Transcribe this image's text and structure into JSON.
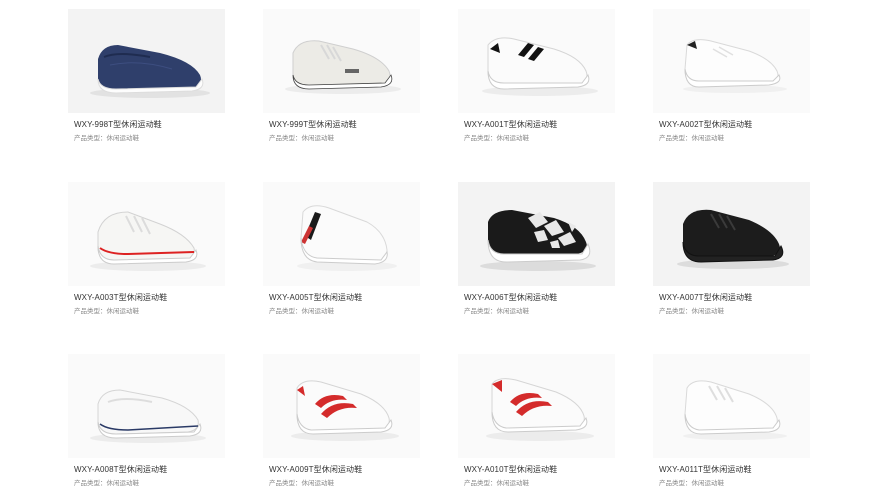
{
  "products": [
    {
      "model": "WXY-998T型休闲运动鞋",
      "category_label": "产品类型：",
      "category_value": "休闲运动鞋",
      "shoe": "navy-slip-on-canvas-icon"
    },
    {
      "model": "WXY-999T型休闲运动鞋",
      "category_label": "产品类型：",
      "category_value": "休闲运动鞋",
      "shoe": "white-lace-up-canvas-icon"
    },
    {
      "model": "WXY-A001T型休闲运动鞋",
      "category_label": "产品类型：",
      "category_value": "休闲运动鞋",
      "shoe": "white-sneaker-black-stripes-icon"
    },
    {
      "model": "WXY-A002T型休闲运动鞋",
      "category_label": "产品类型：",
      "category_value": "休闲运动鞋",
      "shoe": "white-leather-sneaker-icon"
    },
    {
      "model": "WXY-A003T型休闲运动鞋",
      "category_label": "产品类型：",
      "category_value": "休闲运动鞋",
      "shoe": "white-canvas-red-line-icon"
    },
    {
      "model": "WXY-A005T型休闲运动鞋",
      "category_label": "产品类型：",
      "category_value": "休闲运动鞋",
      "shoe": "white-slip-on-striped-icon"
    },
    {
      "model": "WXY-A006T型休闲运动鞋",
      "category_label": "产品类型：",
      "category_value": "休闲运动鞋",
      "shoe": "black-geometric-platform-icon"
    },
    {
      "model": "WXY-A007T型休闲运动鞋",
      "category_label": "产品类型：",
      "category_value": "休闲运动鞋",
      "shoe": "black-canvas-low-top-icon"
    },
    {
      "model": "WXY-A008T型休闲运动鞋",
      "category_label": "产品类型：",
      "category_value": "休闲运动鞋",
      "shoe": "white-slip-on-canvas-icon"
    },
    {
      "model": "WXY-A009T型休闲运动鞋",
      "category_label": "产品类型：",
      "category_value": "休闲运动鞋",
      "shoe": "white-sneaker-red-stripes-icon"
    },
    {
      "model": "WXY-A010T型休闲运动鞋",
      "category_label": "产品类型：",
      "category_value": "休闲运动鞋",
      "shoe": "white-sneaker-red-stripes-icon"
    },
    {
      "model": "WXY-A011T型休闲运动鞋",
      "category_label": "产品类型：",
      "category_value": "休闲运动鞋",
      "shoe": "white-leather-sneaker-icon"
    }
  ]
}
